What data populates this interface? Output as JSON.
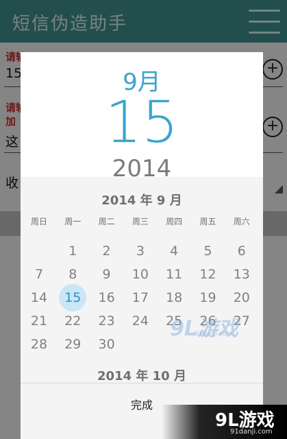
{
  "app": {
    "title": "短信伪造助手"
  },
  "form": {
    "label_1": "请输",
    "value_1": "15",
    "label_2a": "请输",
    "label_2b": "加",
    "value_2": "这",
    "select_value": "收",
    "plus_symbol": "+"
  },
  "dialog": {
    "header": {
      "month": "9月",
      "day": "15",
      "year": "2014"
    },
    "calendar": {
      "month_title": "2014 年 9 月",
      "weekdays": [
        "周日",
        "周一",
        "周二",
        "周三",
        "周四",
        "周五",
        "周六"
      ],
      "selected_day": 15,
      "first_weekday_index": 1,
      "days_in_month": 30,
      "next_month_title": "2014 年 10 月"
    },
    "done_label": "完成"
  },
  "colors": {
    "appbar": "#3e8f8c",
    "accent": "#33a6d6",
    "selected_circle": "#c9e6f4"
  },
  "watermark": {
    "mid_logo": "9L游戏",
    "mid_url": "91danji.com",
    "corner_logo": "9L游戏",
    "corner_url": "91danji.com"
  }
}
